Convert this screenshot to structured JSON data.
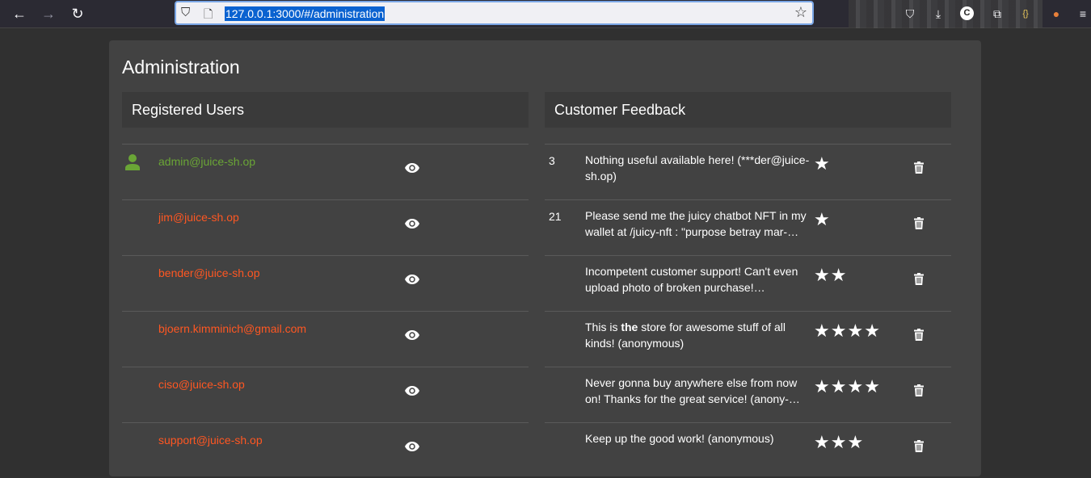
{
  "browser": {
    "url": "127.0.0.1:3000/#/administration"
  },
  "page": {
    "title": "Administration"
  },
  "users": {
    "header": "Registered Users",
    "colors": {
      "admin": "#6aa536",
      "user": "#ff5722"
    },
    "items": [
      {
        "email": "admin@juice-sh.op",
        "admin": true
      },
      {
        "email": "jim@juice-sh.op",
        "admin": false
      },
      {
        "email": "bender@juice-sh.op",
        "admin": false
      },
      {
        "email": "bjoern.kimminich@gmail.com",
        "admin": false
      },
      {
        "email": "ciso@juice-sh.op",
        "admin": false
      },
      {
        "email": "support@juice-sh.op",
        "admin": false
      }
    ]
  },
  "feedback": {
    "header": "Customer Feedback",
    "items": [
      {
        "user_id": "3",
        "pre": "Nothing useful available here! (***der@juice-sh.op)",
        "bold": "",
        "post": "",
        "rating": 1
      },
      {
        "user_id": "21",
        "pre": "Please send me the juicy chatbot NFT in my wallet at /juicy-nft : \"purpose betray mar-…",
        "bold": "",
        "post": "",
        "rating": 1
      },
      {
        "user_id": "",
        "pre": "Incompetent customer support! Can't even upload photo of broken purchase!…",
        "bold": "",
        "post": "",
        "rating": 2
      },
      {
        "user_id": "",
        "pre": "This is ",
        "bold": "the",
        "post": " store for awesome stuff of all kinds! (anonymous)",
        "rating": 4
      },
      {
        "user_id": "",
        "pre": "Never gonna buy anywhere else from now on! Thanks for the great service! (anony-…",
        "bold": "",
        "post": "",
        "rating": 4
      },
      {
        "user_id": "",
        "pre": "Keep up the good work! (anonymous)",
        "bold": "",
        "post": "",
        "rating": 3
      }
    ]
  }
}
